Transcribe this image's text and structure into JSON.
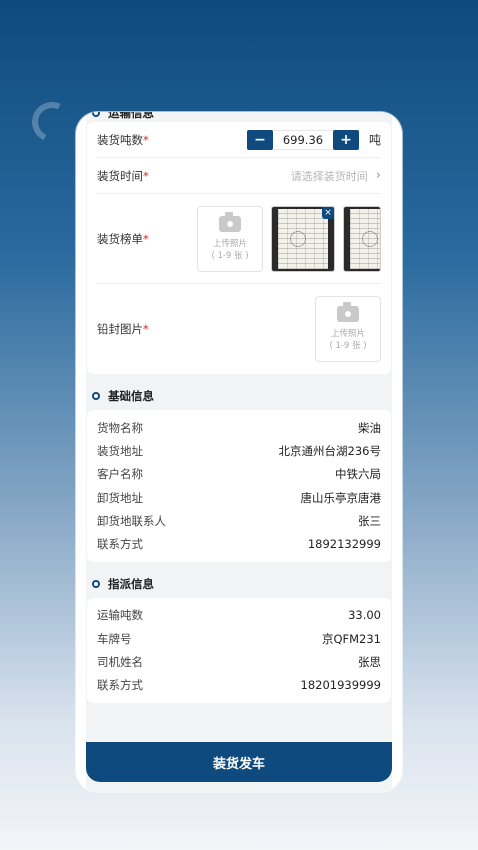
{
  "transport": {
    "section_title": "运输信息",
    "tonnage_label": "装货吨数",
    "tonnage_value": "699.36",
    "tonnage_unit": "吨",
    "minus": "−",
    "plus": "+",
    "time_label": "装货时间",
    "time_placeholder": "请选择装货时间",
    "weighbill_label": "装货榜单",
    "seal_label": "铅封图片",
    "upload_text": "上传照片",
    "upload_hint": "( 1-9 张 )",
    "required_mark": "*"
  },
  "basic": {
    "section_title": "基础信息",
    "rows": [
      {
        "label": "货物名称",
        "value": "柴油"
      },
      {
        "label": "装货地址",
        "value": "北京通州台湖236号"
      },
      {
        "label": "客户名称",
        "value": "中铁六局"
      },
      {
        "label": "卸货地址",
        "value": "唐山乐亭京唐港"
      },
      {
        "label": "卸货地联系人",
        "value": "张三"
      },
      {
        "label": "联系方式",
        "value": "1892132999"
      }
    ]
  },
  "dispatch": {
    "section_title": "指派信息",
    "rows": [
      {
        "label": "运输吨数",
        "value": "33.00"
      },
      {
        "label": "车牌号",
        "value": "京QFM231"
      },
      {
        "label": "司机姓名",
        "value": "张思"
      },
      {
        "label": "联系方式",
        "value": "18201939999"
      }
    ]
  },
  "submit_label": "装货发车",
  "colors": {
    "primary": "#0f4a7e",
    "required": "#e02020"
  }
}
